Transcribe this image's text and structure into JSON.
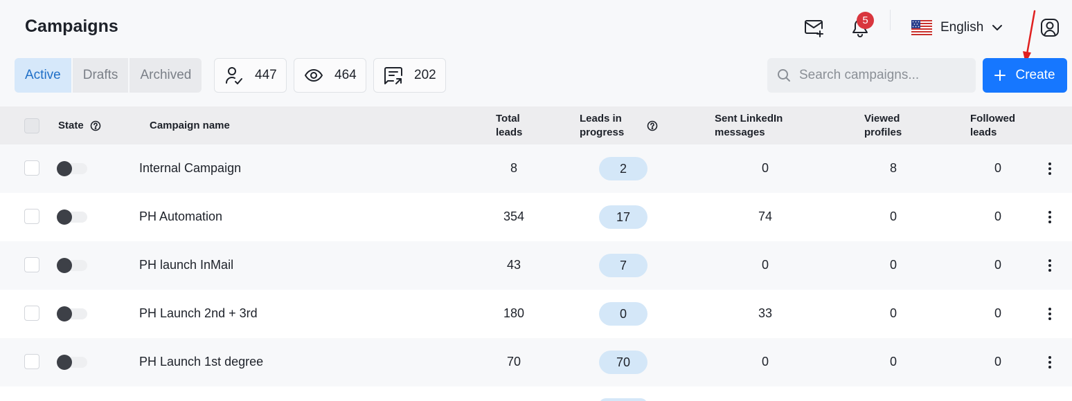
{
  "header": {
    "title": "Campaigns",
    "notifications_count": "5",
    "language": "English"
  },
  "tabs": [
    {
      "label": "Active",
      "active": true
    },
    {
      "label": "Drafts",
      "active": false
    },
    {
      "label": "Archived",
      "active": false
    }
  ],
  "stats": {
    "leads": "447",
    "views": "464",
    "messages": "202"
  },
  "search": {
    "placeholder": "Search campaigns...",
    "value": ""
  },
  "create_label": "Create",
  "table": {
    "columns": {
      "state": "State",
      "name": "Campaign name",
      "total_leads": "Total leads",
      "leads_in_progress": "Leads in progress",
      "sent_linkedin": "Sent LinkedIn messages",
      "viewed_profiles": "Viewed profiles",
      "followed_leads": "Followed leads"
    },
    "rows": [
      {
        "name": "Internal Campaign",
        "total": "8",
        "progress": "2",
        "sent": "0",
        "viewed": "8",
        "followed": "0"
      },
      {
        "name": "PH Automation",
        "total": "354",
        "progress": "17",
        "sent": "74",
        "viewed": "0",
        "followed": "0"
      },
      {
        "name": "PH launch InMail",
        "total": "43",
        "progress": "7",
        "sent": "0",
        "viewed": "0",
        "followed": "0"
      },
      {
        "name": "PH Launch 2nd + 3rd",
        "total": "180",
        "progress": "0",
        "sent": "33",
        "viewed": "0",
        "followed": "0"
      },
      {
        "name": "PH Launch 1st degree",
        "total": "70",
        "progress": "70",
        "sent": "0",
        "viewed": "0",
        "followed": "0"
      }
    ]
  },
  "colors": {
    "accent": "#1677ff",
    "active_tab_bg": "#d6e8fa",
    "pill_bg": "#d4e7f8",
    "badge": "#d9363e",
    "annotation_arrow": "#e02020"
  }
}
